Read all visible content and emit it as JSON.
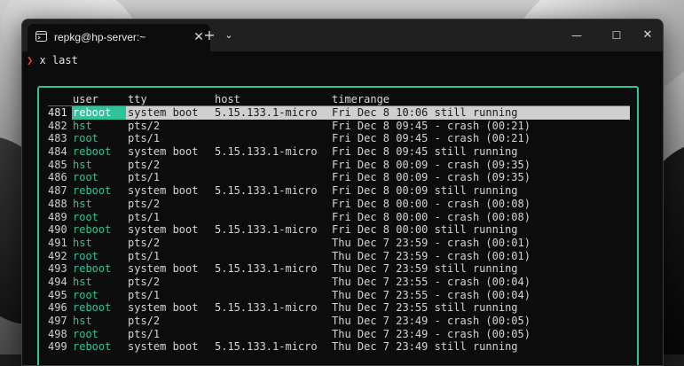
{
  "window": {
    "tab_title": "repkg@hp-server:~",
    "tab_close": "✕",
    "new_tab": "+",
    "dropdown": "⌄",
    "minimize": "—",
    "maximize": "☐",
    "close": "✕"
  },
  "terminal": {
    "prompt_symbol": "❯",
    "command": "x last"
  },
  "table": {
    "columns": [
      "user",
      "tty",
      "host",
      "timerange"
    ],
    "selected_index": 0,
    "rows": [
      {
        "num": "481",
        "user": "reboot",
        "tty": "system boot",
        "host": "5.15.133.1-micro",
        "time": "Fri Dec 8 10:06 still running"
      },
      {
        "num": "482",
        "user": "hst",
        "tty": "pts/2",
        "host": "",
        "time": "Fri Dec 8 09:45 - crash (00:21)"
      },
      {
        "num": "483",
        "user": "root",
        "tty": "pts/1",
        "host": "",
        "time": "Fri Dec 8 09:45 - crash (00:21)"
      },
      {
        "num": "484",
        "user": "reboot",
        "tty": "system boot",
        "host": "5.15.133.1-micro",
        "time": "Fri Dec 8 09:45 still running"
      },
      {
        "num": "485",
        "user": "hst",
        "tty": "pts/2",
        "host": "",
        "time": "Fri Dec 8 00:09 - crash (09:35)"
      },
      {
        "num": "486",
        "user": "root",
        "tty": "pts/1",
        "host": "",
        "time": "Fri Dec 8 00:09 - crash (09:35)"
      },
      {
        "num": "487",
        "user": "reboot",
        "tty": "system boot",
        "host": "5.15.133.1-micro",
        "time": "Fri Dec 8 00:09 still running"
      },
      {
        "num": "488",
        "user": "hst",
        "tty": "pts/2",
        "host": "",
        "time": "Fri Dec 8 00:00 - crash (00:08)"
      },
      {
        "num": "489",
        "user": "root",
        "tty": "pts/1",
        "host": "",
        "time": "Fri Dec 8 00:00 - crash (00:08)"
      },
      {
        "num": "490",
        "user": "reboot",
        "tty": "system boot",
        "host": "5.15.133.1-micro",
        "time": "Fri Dec 8 00:00 still running"
      },
      {
        "num": "491",
        "user": "hst",
        "tty": "pts/2",
        "host": "",
        "time": "Thu Dec 7 23:59 - crash (00:01)"
      },
      {
        "num": "492",
        "user": "root",
        "tty": "pts/1",
        "host": "",
        "time": "Thu Dec 7 23:59 - crash (00:01)"
      },
      {
        "num": "493",
        "user": "reboot",
        "tty": "system boot",
        "host": "5.15.133.1-micro",
        "time": "Thu Dec 7 23:59 still running"
      },
      {
        "num": "494",
        "user": "hst",
        "tty": "pts/2",
        "host": "",
        "time": "Thu Dec 7 23:55 - crash (00:04)"
      },
      {
        "num": "495",
        "user": "root",
        "tty": "pts/1",
        "host": "",
        "time": "Thu Dec 7 23:55 - crash (00:04)"
      },
      {
        "num": "496",
        "user": "reboot",
        "tty": "system boot",
        "host": "5.15.133.1-micro",
        "time": "Thu Dec 7 23:55 still running"
      },
      {
        "num": "497",
        "user": "hst",
        "tty": "pts/2",
        "host": "",
        "time": "Thu Dec 7 23:49 - crash (00:05)"
      },
      {
        "num": "498",
        "user": "root",
        "tty": "pts/1",
        "host": "",
        "time": "Thu Dec 7 23:49 - crash (00:05)"
      },
      {
        "num": "499",
        "user": "reboot",
        "tty": "system boot",
        "host": "5.15.133.1-micro",
        "time": "Thu Dec 7 23:49 still running"
      }
    ]
  },
  "colors": {
    "accent": "#2ec49b",
    "prompt": "#e0473a",
    "background": "#0c0c0c",
    "selection": "#cfcfcf"
  }
}
